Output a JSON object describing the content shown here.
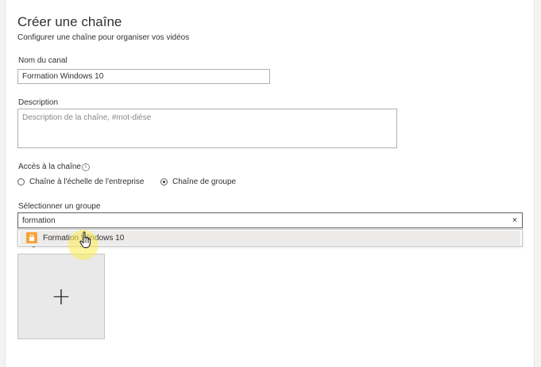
{
  "dialog": {
    "title": "Créer une chaîne",
    "subtitle": "Configurer une chaîne pour organiser vos vidéos"
  },
  "channel_name": {
    "label": "Nom du canal",
    "value": "Formation Windows 10"
  },
  "description": {
    "label": "Description",
    "placeholder": "Description de la chaîne, #mot-dièse"
  },
  "access": {
    "label": "Accès à la chaîne",
    "info_glyph": "i",
    "options": [
      {
        "label": "Chaîne à l'échelle de l'entreprise",
        "selected": false
      },
      {
        "label": "Chaîne de groupe",
        "selected": true
      }
    ]
  },
  "group_select": {
    "label": "Sélectionner un groupe",
    "value": "formation",
    "clear_glyph": "×",
    "suggestions": [
      {
        "label": "Formation Windows 10",
        "icon": "group-icon",
        "icon_color": "#f7a23b"
      }
    ]
  },
  "channel_image": {
    "label_partial": "Image de chaîne personnalisée",
    "add_glyph": "+"
  },
  "colors": {
    "highlight": "#edebe9",
    "cursor_halo": "#ffec50",
    "group_icon": "#f7a23b"
  }
}
